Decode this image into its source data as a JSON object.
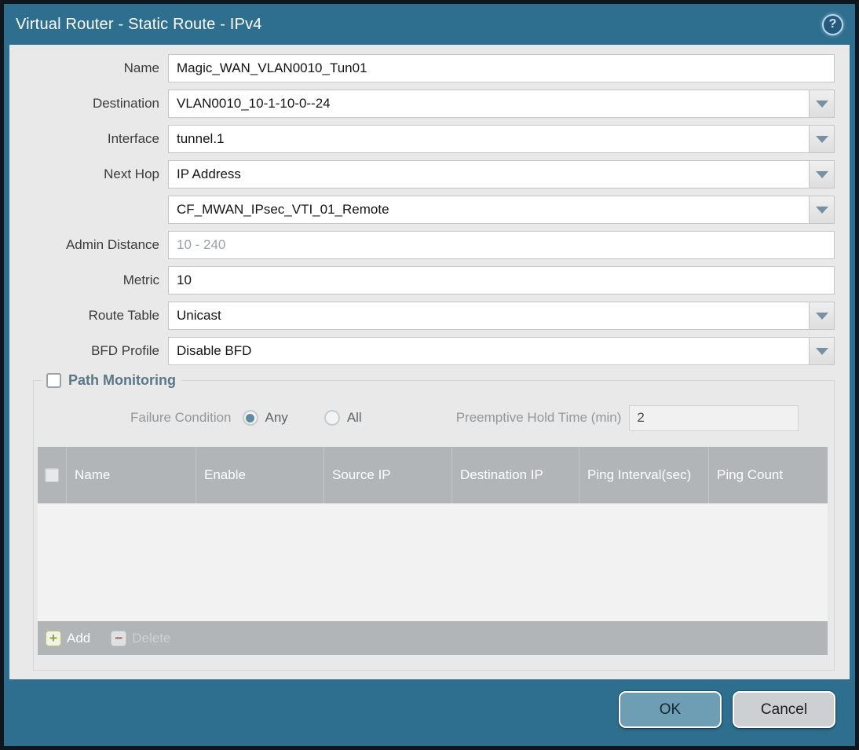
{
  "dialog": {
    "title": "Virtual Router - Static Route - IPv4",
    "help_glyph": "?"
  },
  "form": {
    "fields": [
      {
        "label": "Name",
        "value": "Magic_WAN_VLAN0010_Tun01",
        "type": "text"
      },
      {
        "label": "Destination",
        "value": "VLAN0010_10-1-10-0--24",
        "type": "dropdown"
      },
      {
        "label": "Interface",
        "value": "tunnel.1",
        "type": "dropdown"
      },
      {
        "label": "Next Hop",
        "value": "IP Address",
        "type": "dropdown"
      },
      {
        "label": "",
        "value": "CF_MWAN_IPsec_VTI_01_Remote",
        "type": "dropdown"
      },
      {
        "label": "Admin Distance",
        "value": "",
        "placeholder": "10 - 240",
        "type": "text"
      },
      {
        "label": "Metric",
        "value": "10",
        "type": "text"
      },
      {
        "label": "Route Table",
        "value": "Unicast",
        "type": "dropdown"
      },
      {
        "label": "BFD Profile",
        "value": "Disable BFD",
        "type": "dropdown"
      }
    ]
  },
  "path_monitoring": {
    "legend": "Path Monitoring",
    "checkbox_checked": false,
    "failure_condition_label": "Failure Condition",
    "radio_any_label": "Any",
    "radio_any_selected": true,
    "radio_all_label": "All",
    "radio_all_selected": false,
    "preemptive_label": "Preemptive Hold Time (min)",
    "preemptive_value": "2",
    "table": {
      "columns": [
        "Name",
        "Enable",
        "Source IP",
        "Destination IP",
        "Ping Interval(sec)",
        "Ping Count"
      ],
      "rows": []
    },
    "add_label": "Add",
    "delete_label": "Delete",
    "add_icon_glyph": "+",
    "delete_icon_glyph": "−"
  },
  "footer": {
    "ok_label": "OK",
    "cancel_label": "Cancel"
  },
  "colors": {
    "frame_teal": "#2e6e8e",
    "outer_border": "#0f161d",
    "panel_bg": "#e9e9e9",
    "grid_header_bg": "#b1b5b8",
    "ok_button_bg": "#6d9eb4",
    "cancel_button_bg": "#ccd0d3",
    "legend_text": "#5a7787",
    "radio_selected_fill": "#5e8ca1",
    "trigger_arrow": "#7591a3",
    "add_plus_green": "#8ea03c",
    "delete_minus_red": "#a05a50"
  }
}
